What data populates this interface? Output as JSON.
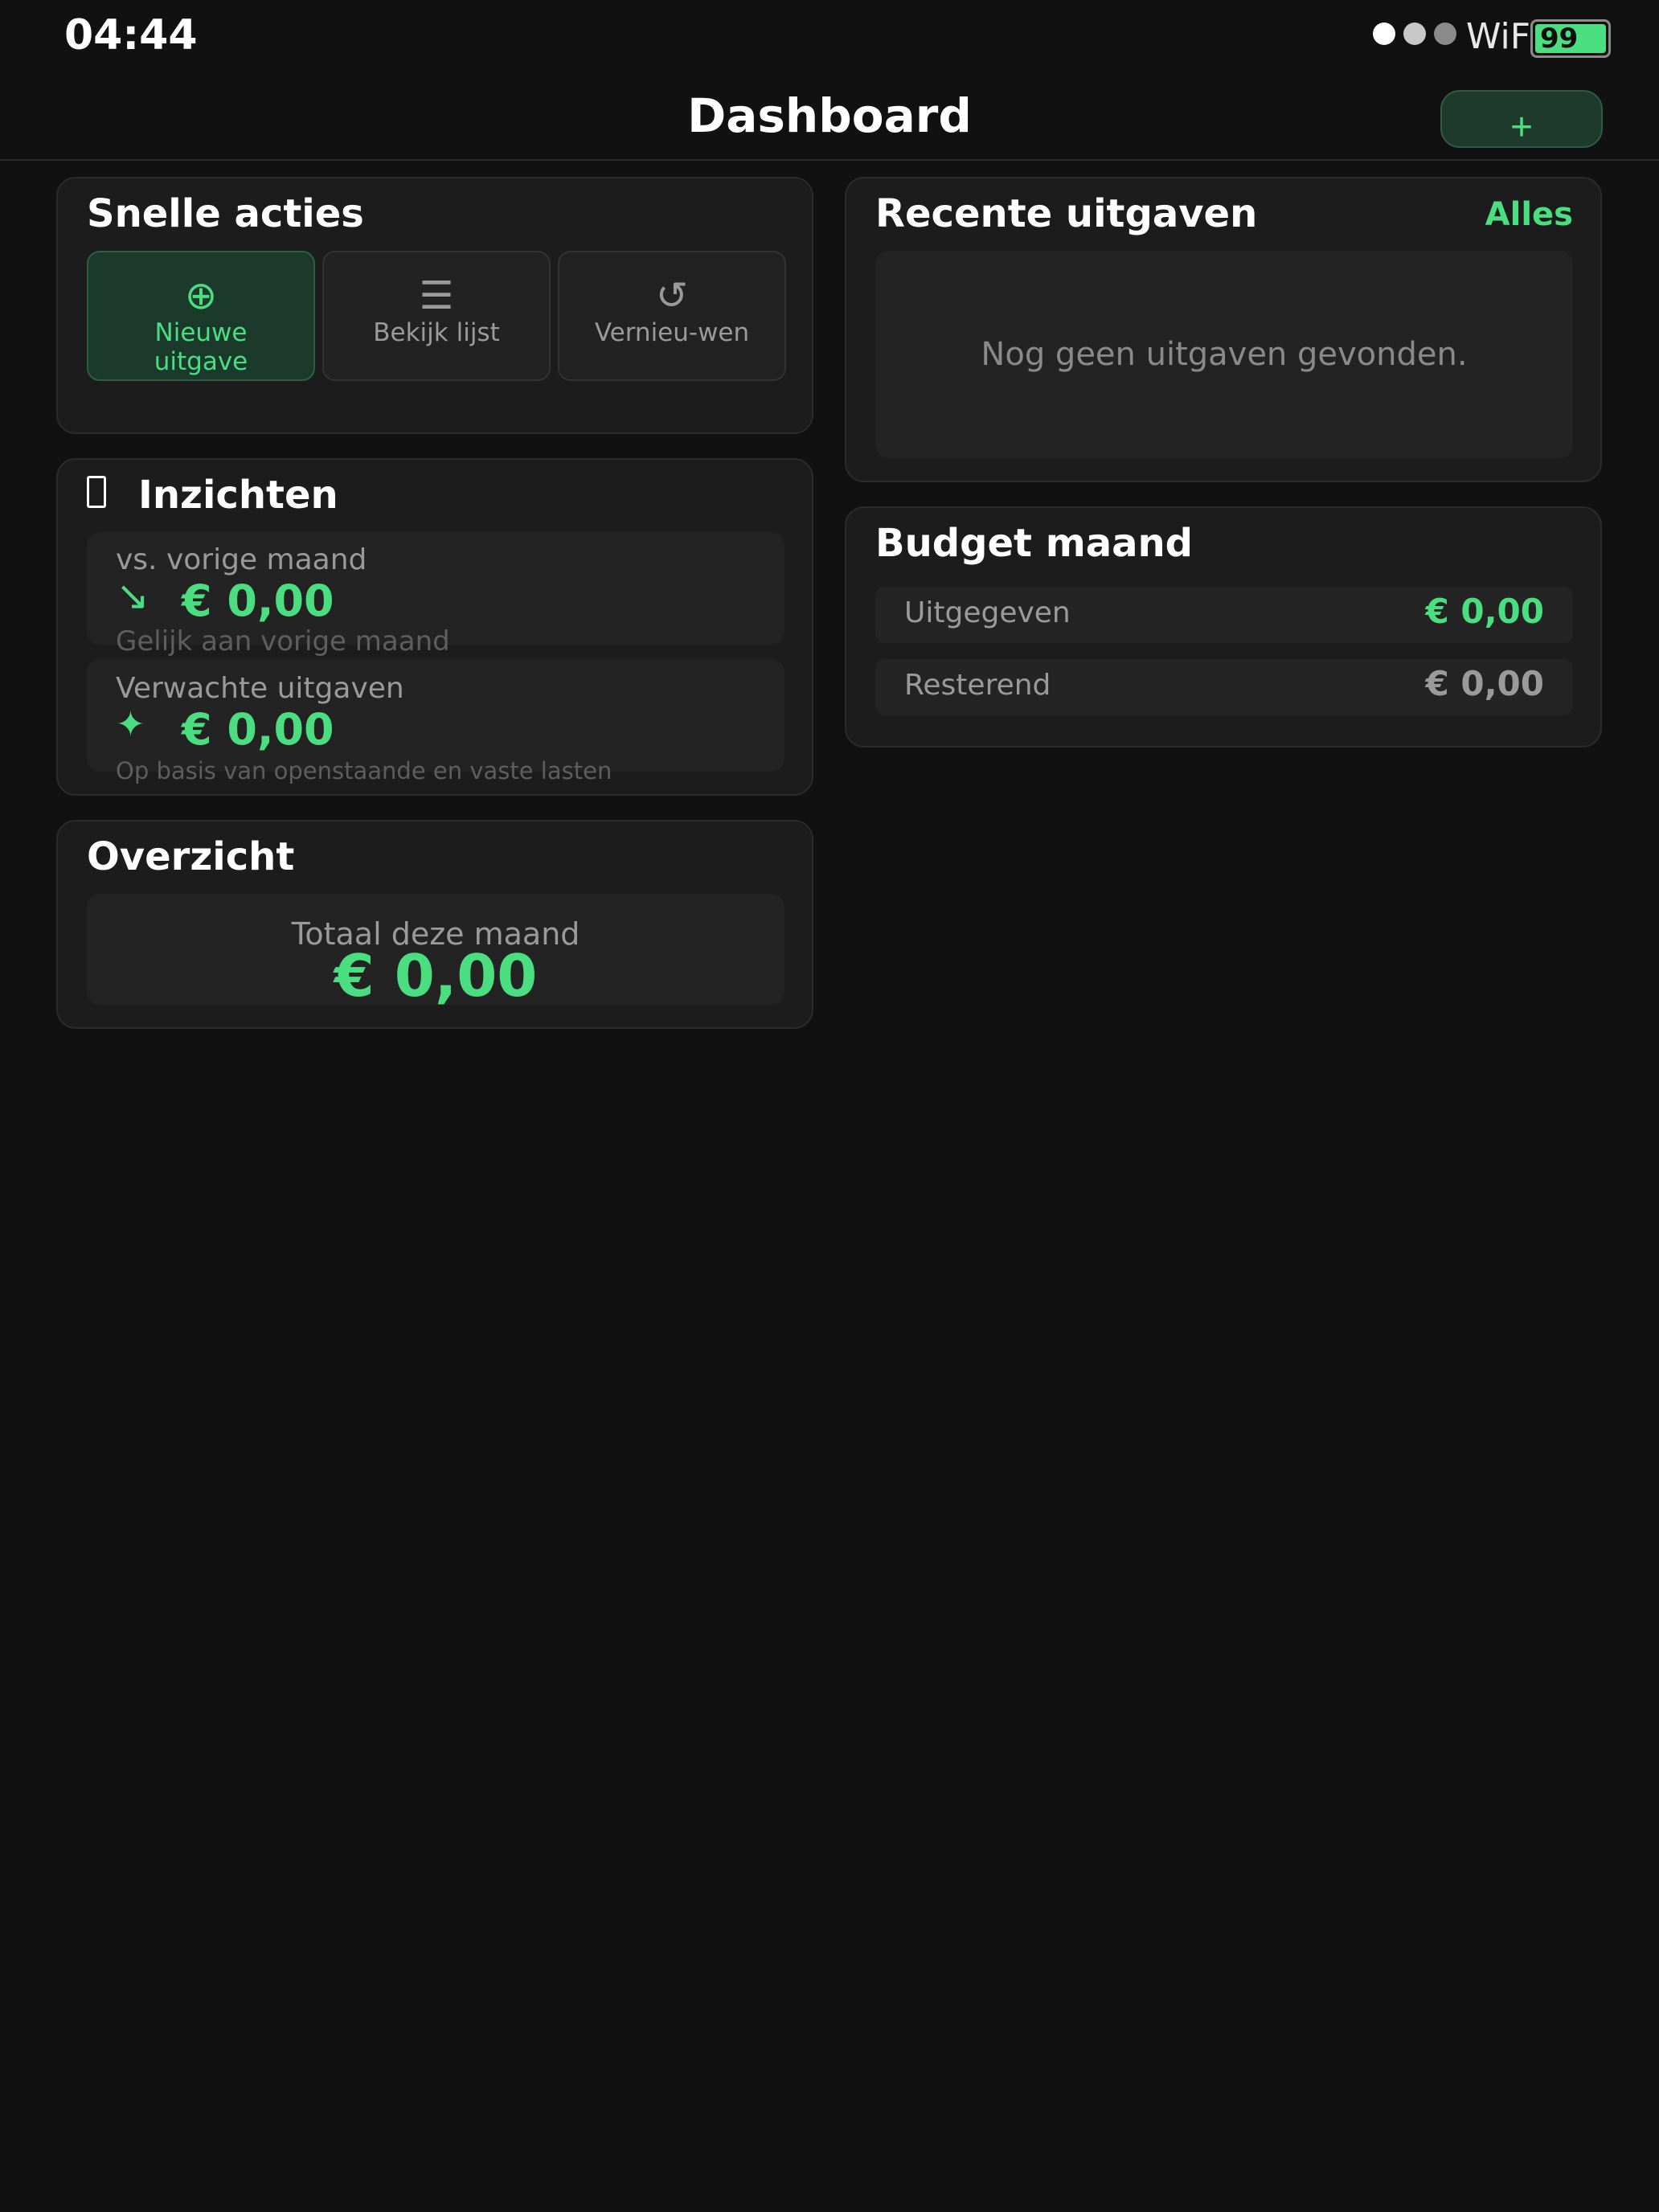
{
  "status_bar": {
    "time": "04:44",
    "wifi": "WiFi",
    "battery": "99"
  },
  "header": {
    "title": "Dashboard",
    "add_label": "+"
  },
  "quick_actions": {
    "title": "Snelle acties",
    "buttons": [
      {
        "icon": "⊕",
        "label": "Nieuwe uitgave"
      },
      {
        "icon": "☰",
        "label": "Bekijk lijst"
      },
      {
        "icon": "↺",
        "label": "Vernieu-wen"
      }
    ]
  },
  "insights": {
    "title": "Inzichten",
    "items": [
      {
        "label": "vs. vorige maand",
        "icon": "↘",
        "value": "€ 0,00",
        "note": "Gelijk aan vorige maand"
      },
      {
        "label": "Verwachte uitgaven",
        "icon": "✦",
        "value": "€ 0,00",
        "note": "Op basis van openstaande en vaste lasten"
      }
    ]
  },
  "overview": {
    "title": "Overzicht",
    "label": "Totaal deze maand",
    "value": "€ 0,00"
  },
  "recent": {
    "title": "Recente uitgaven",
    "all_link": "Alles",
    "empty_text": "Nog geen uitgaven gevonden."
  },
  "budget": {
    "title": "Budget maand",
    "rows": [
      {
        "label": "Uitgegeven",
        "value": "€ 0,00"
      },
      {
        "label": "Resterend",
        "value": "€ 0,00"
      }
    ]
  },
  "colors": {
    "background": "#111111",
    "card": "#1c1c1c",
    "accent": "#4ade80",
    "muted_text": "#9a9a9a"
  }
}
